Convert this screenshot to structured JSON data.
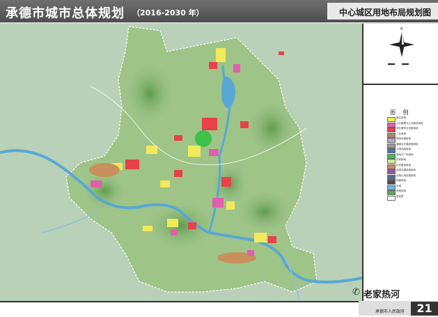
{
  "header": {
    "title": "承德市城市总体规划",
    "years": "（2016-2030 年）",
    "subtitle": "中心城区用地布局规划图"
  },
  "legend": {
    "title": "图 例",
    "items": [
      {
        "color": "#f2ea5a",
        "label": "居住用地"
      },
      {
        "color": "#e05fae",
        "label": "公共管理与公共服务用地"
      },
      {
        "color": "#e8414a",
        "label": "商业服务业设施用地"
      },
      {
        "color": "#a98a70",
        "label": "工业用地"
      },
      {
        "color": "#b8a6c9",
        "label": "物流仓储用地"
      },
      {
        "color": "#9b9b9b",
        "label": "道路与交通设施用地"
      },
      {
        "color": "#4a74b4",
        "label": "公用设施用地"
      },
      {
        "color": "#3ec24a",
        "label": "绿地与广场用地"
      },
      {
        "color": "#d5e79a",
        "label": "农林用地"
      },
      {
        "color": "#c98f5c",
        "label": "村庄建设用地"
      },
      {
        "color": "#8a5ea8",
        "label": "区域交通设施用地"
      },
      {
        "color": "#5a6a86",
        "label": "区域公用设施用地"
      },
      {
        "color": "#4d4d4d",
        "label": "特殊用地"
      },
      {
        "color": "#6fb7e0",
        "label": "水域"
      },
      {
        "color": "#59a85c",
        "label": "其他用地"
      },
      {
        "color": "#ffffff",
        "label": "规划界"
      }
    ]
  },
  "footer": {
    "gov": "承德市人民政府",
    "page": "21",
    "watermark": "老家热河"
  }
}
